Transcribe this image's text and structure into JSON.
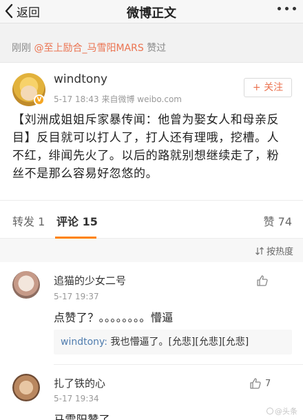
{
  "navbar": {
    "back_label": "返回",
    "title": "微博正文"
  },
  "liked_bar": {
    "time": "刚刚",
    "user": "@至上励合_马雪阳MARS",
    "action": "赞过"
  },
  "post": {
    "username": "windtony",
    "meta": "5-17 18:43  来自微博 weibo.com",
    "follow_label": "+ 关注",
    "badge": "V",
    "content": "【刘洲成姐姐斥家暴传闻：他曾为娶女人和母亲反目】反目就可以打人了，打人还有理哦，挖槽。人不红，绯闻先火了。以后的路就别想继续走了，粉丝不是那么容易好忽悠的。"
  },
  "tabs": {
    "repost": "转发 1",
    "comments": "评论 15",
    "likes": "赞 74"
  },
  "sort": {
    "label": "按热度"
  },
  "comments": [
    {
      "name": "追猫的少女二号",
      "time": "5-17 19:37",
      "text": "点赞了？。。。。。。。。懵逼",
      "reply_user": "windtony:",
      "reply_text": " 我也懵逼了。[允悲][允悲][允悲]"
    },
    {
      "name": "扎了铁的心",
      "time": "5-17 19:34",
      "likes": "7",
      "text": "马雪阳赞了"
    }
  ],
  "watermark": "@头条"
}
